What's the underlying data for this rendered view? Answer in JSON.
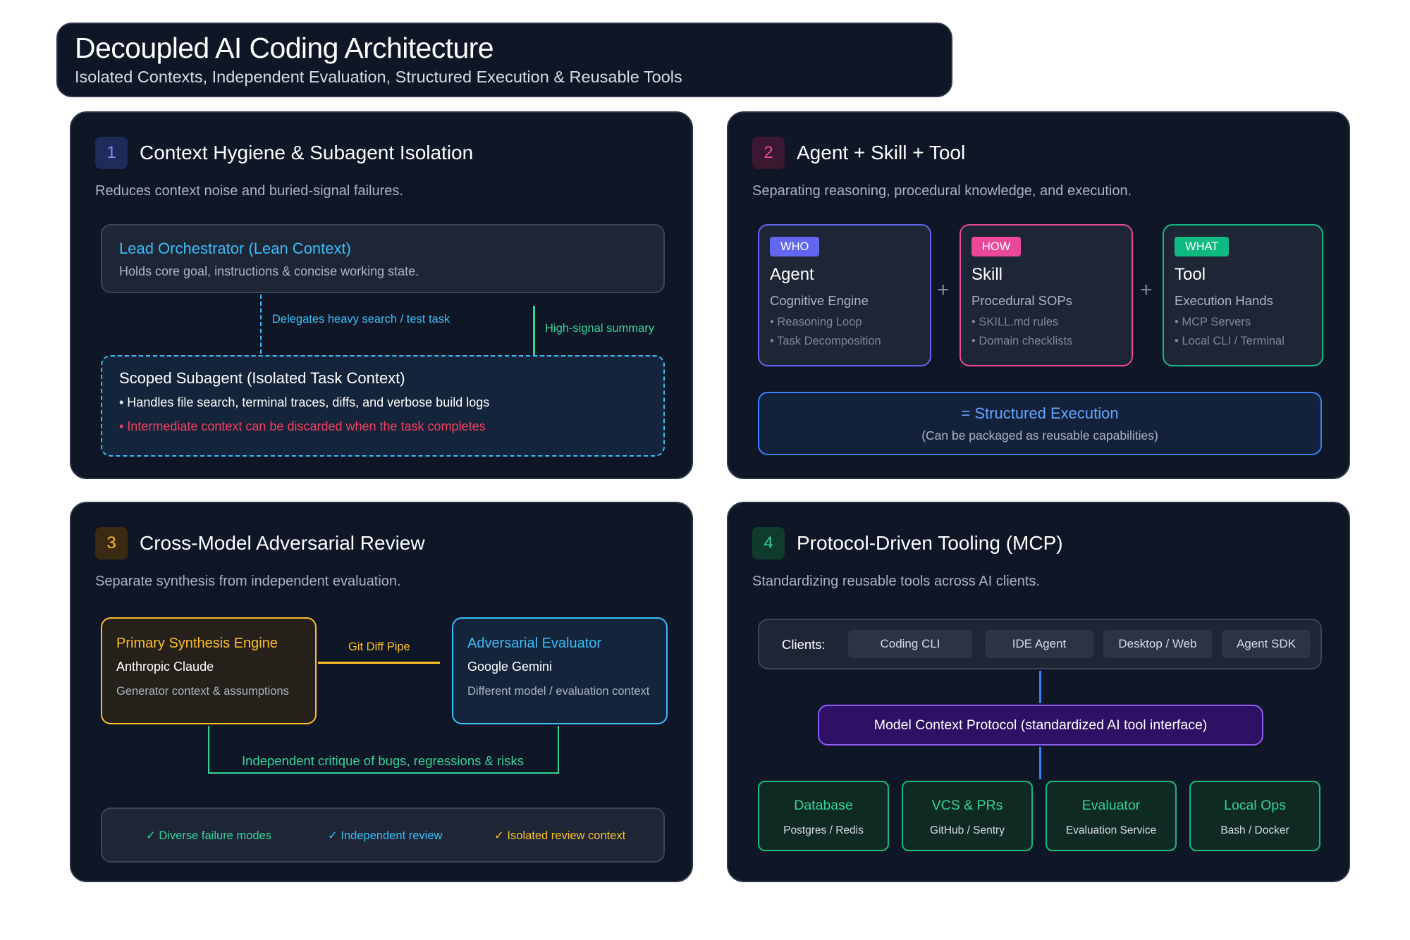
{
  "header": {
    "title": "Decoupled AI Coding Architecture",
    "subtitle": "Isolated Contexts, Independent Evaluation, Structured Execution & Reusable Tools"
  },
  "colors": {
    "background": "#0f1626",
    "blue": "#38bdf8",
    "pink": "#ec4899",
    "green": "#34d399",
    "amber": "#fbbf24",
    "purple": "#8b5cf6",
    "red": "#f43f5e"
  },
  "panel1": {
    "number": "1",
    "title": "Context Hygiene & Subagent Isolation",
    "description": "Reduces context noise and buried-signal failures.",
    "lead": {
      "title": "Lead Orchestrator (Lean Context)",
      "subtitle": "Holds core goal, instructions & concise working state."
    },
    "delegate_label": "Delegates heavy search / test task",
    "summary_label": "High-signal summary",
    "subagent": {
      "title": "Scoped Subagent (Isolated Task Context)",
      "bullet1": "• Handles file search, terminal traces, diffs, and verbose build logs",
      "bullet2": "• Intermediate context can be discarded when the task completes"
    }
  },
  "panel2": {
    "number": "2",
    "title": "Agent + Skill + Tool",
    "description": "Separating reasoning, procedural knowledge, and execution.",
    "cards": [
      {
        "badge": "WHO",
        "name": "Agent",
        "role": "Cognitive Engine",
        "bullet1": "• Reasoning Loop",
        "bullet2": "• Task Decomposition",
        "color": "#6366f1"
      },
      {
        "badge": "HOW",
        "name": "Skill",
        "role": "Procedural SOPs",
        "bullet1": "• SKILL.md rules",
        "bullet2": "• Domain checklists",
        "color": "#ec4899"
      },
      {
        "badge": "WHAT",
        "name": "Tool",
        "role": "Execution Hands",
        "bullet1": "• MCP Servers",
        "bullet2": "• Local CLI / Terminal",
        "color": "#10b981"
      }
    ],
    "plus": "+",
    "result": {
      "title": "= Structured Execution",
      "subtitle": "(Can be packaged as reusable capabilities)"
    }
  },
  "panel3": {
    "number": "3",
    "title": "Cross-Model Adversarial Review",
    "description": "Separate synthesis from independent evaluation.",
    "primary": {
      "title": "Primary Synthesis Engine",
      "model": "Anthropic Claude",
      "context": "Generator context & assumptions"
    },
    "pipe_label": "Git Diff Pipe",
    "evaluator": {
      "title": "Adversarial Evaluator",
      "model": "Google Gemini",
      "context": "Different model / evaluation context"
    },
    "critique_label": "Independent critique of bugs, regressions & risks",
    "checks": [
      {
        "label": "✓ Diverse failure modes",
        "color": "#34d399"
      },
      {
        "label": "✓ Independent review",
        "color": "#38bdf8"
      },
      {
        "label": "✓ Isolated review context",
        "color": "#fbbf24"
      }
    ]
  },
  "panel4": {
    "number": "4",
    "title": "Protocol-Driven Tooling (MCP)",
    "description": "Standardizing reusable tools across AI clients.",
    "clients_label": "Clients:",
    "clients": [
      "Coding CLI",
      "IDE Agent",
      "Desktop / Web",
      "Agent SDK"
    ],
    "protocol": "Model Context Protocol (standardized AI tool interface)",
    "servers": [
      {
        "title": "Database",
        "subtitle": "Postgres / Redis"
      },
      {
        "title": "VCS & PRs",
        "subtitle": "GitHub / Sentry"
      },
      {
        "title": "Evaluator",
        "subtitle": "Evaluation Service"
      },
      {
        "title": "Local Ops",
        "subtitle": "Bash / Docker"
      }
    ]
  }
}
